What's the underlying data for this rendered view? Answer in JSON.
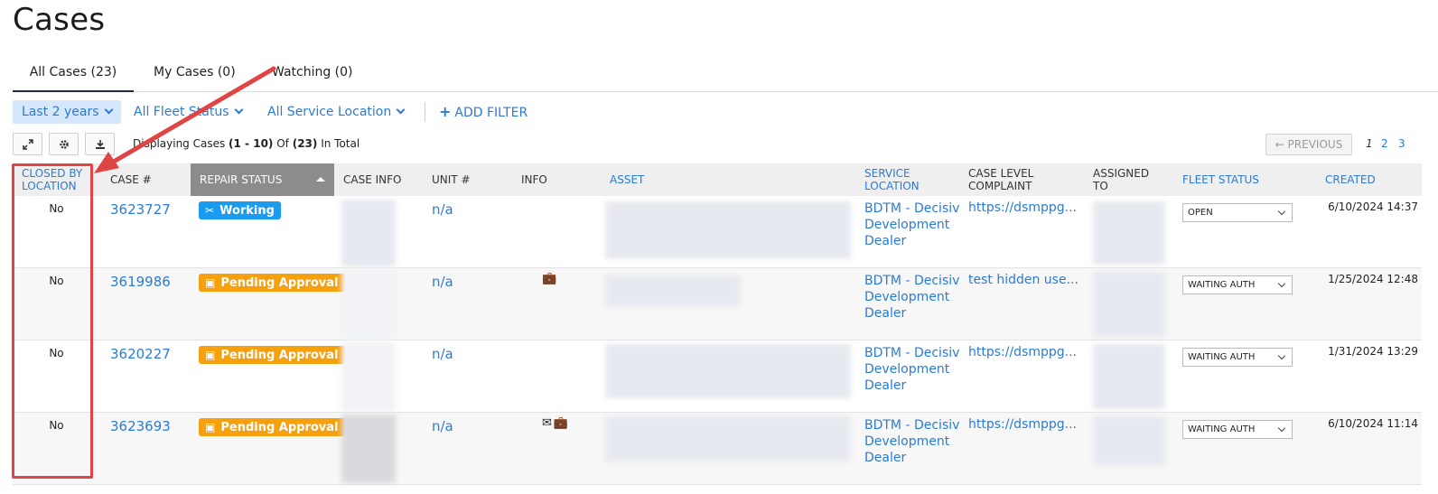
{
  "page": {
    "title": "Cases"
  },
  "tabs": [
    {
      "label": "All Cases (23)",
      "active": true
    },
    {
      "label": "My Cases (0)",
      "active": false
    },
    {
      "label": "Watching (0)",
      "active": false
    }
  ],
  "filters": {
    "date": "Last 2 years",
    "fleet_status": "All Fleet Status",
    "service_location": "All Service Location",
    "add_filter": "ADD FILTER"
  },
  "toolbar": {
    "display_prefix": "Displaying Cases ",
    "range": "(1 - 10)",
    "of": " Of ",
    "total": "(23)",
    "suffix": " In Total",
    "previous": "← PREVIOUS",
    "pages": [
      "1",
      "2",
      "3"
    ],
    "current_page": "1"
  },
  "columns": {
    "closed_by_location": "CLOSED BY LOCATION",
    "case_no": "CASE #",
    "repair_status": "REPAIR STATUS",
    "case_info": "CASE INFO",
    "unit_no": "UNIT #",
    "info": "INFO",
    "asset": "ASSET",
    "service_location": "SERVICE LOCATION",
    "case_level_complaint": "CASE LEVEL COMPLAINT",
    "assigned_to": "ASSIGNED TO",
    "fleet_status": "FLEET STATUS",
    "created": "CREATED"
  },
  "rows": [
    {
      "closed": "No",
      "case_no": "3623727",
      "status": "Working",
      "status_type": "working",
      "unit": "n/a",
      "info_icons": "",
      "service_location": "BDTM - Decisiv Development Dealer",
      "complaint": "https://dsmppg...",
      "fleet_status": "OPEN",
      "created": "6/10/2024 14:37"
    },
    {
      "closed": "No",
      "case_no": "3619986",
      "status": "Pending Approval",
      "status_type": "pending",
      "unit": "n/a",
      "info_icons": "💼",
      "service_location": "BDTM - Decisiv Development Dealer",
      "complaint": "test hidden use...",
      "fleet_status": "WAITING AUTH",
      "created": "1/25/2024 12:48"
    },
    {
      "closed": "No",
      "case_no": "3620227",
      "status": "Pending Approval",
      "status_type": "pending",
      "unit": "n/a",
      "info_icons": "",
      "service_location": "BDTM - Decisiv Development Dealer",
      "complaint": "https://dsmppg...",
      "fleet_status": "WAITING AUTH",
      "created": "1/31/2024 13:29"
    },
    {
      "closed": "No",
      "case_no": "3623693",
      "status": "Pending Approval",
      "status_type": "pending",
      "unit": "n/a",
      "info_icons": "✉💼",
      "service_location": "BDTM - Decisiv Development Dealer",
      "complaint": "https://dsmppg...",
      "fleet_status": "WAITING AUTH",
      "created": "6/10/2024 11:14"
    }
  ],
  "colors": {
    "link": "#2a7bd4",
    "working": "#1a9bf0",
    "pending": "#f5a00f",
    "annotation": "#e04545"
  }
}
